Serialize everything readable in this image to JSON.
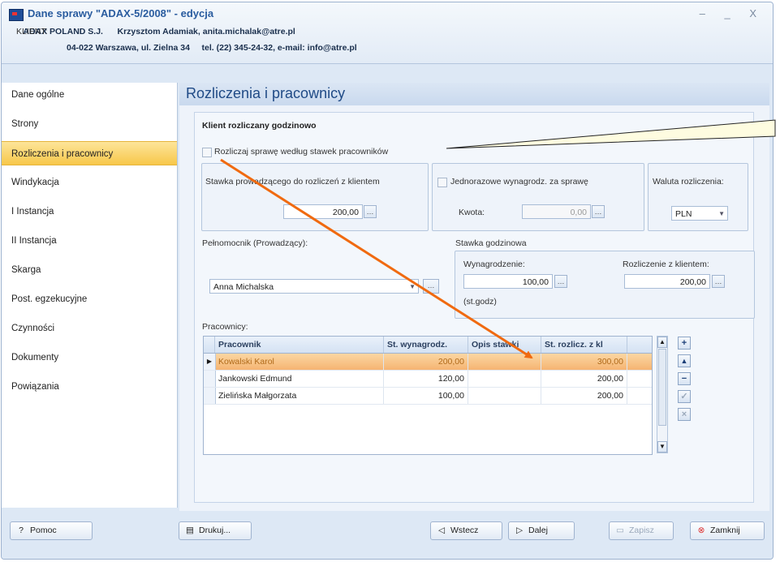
{
  "window": {
    "title": "Dane sprawy \"ADAX-5/2008\" - edycja",
    "controls": "– _ X"
  },
  "client": {
    "label": "KLIENT:",
    "name": "ADAX POLAND S.J.",
    "contacts": "Krzysztom Adamiak, anita.michalak@atre.pl",
    "address": "04-022 Warszawa, ul. Zielna 34",
    "phone_email": "tel. (22) 345-24-32, e-mail: info@atre.pl"
  },
  "sidebar": {
    "items": [
      {
        "label": "Dane ogólne"
      },
      {
        "label": "Strony"
      },
      {
        "label": "Rozliczenia i pracownicy",
        "active": true
      },
      {
        "label": "Windykacja"
      },
      {
        "label": "I Instancja"
      },
      {
        "label": "II Instancja"
      },
      {
        "label": "Skarga"
      },
      {
        "label": "Post. egzekucyjne"
      },
      {
        "label": "Czynności"
      },
      {
        "label": "Dokumenty"
      },
      {
        "label": "Powiązania"
      }
    ]
  },
  "panel": {
    "title": "Rozliczenia i pracownicy",
    "hourly_client": "Klient rozliczany godzinowo",
    "checkbox_label": "Rozliczaj sprawę według stawek pracowników",
    "rate_label": "Stawka prowadzącego do rozliczeń z klientem",
    "rate_value": "200,00",
    "one_time_label": "Jednorazowe wynagrodz. za sprawę",
    "amount_label": "Kwota:",
    "amount_value": "0,00",
    "currency_label": "Waluta rozliczenia:",
    "currency_value": "PLN",
    "attorney_label": "Pełnomocnik (Prowadzący):",
    "attorney_value": "Anna Michalska",
    "hourly_rate_label": "Stawka godzinowa",
    "remuneration_label": "Wynagrodzenie:",
    "remuneration_value": "100,00",
    "client_settlement_label": "Rozliczenie z klientem:",
    "client_settlement_value": "200,00",
    "per_hour": "(st.godz)",
    "employees_label": "Pracownicy:"
  },
  "grid": {
    "columns": [
      "Pracownik",
      "St. wynagrodz.",
      "Opis stawki",
      "St. rozlicz. z kl"
    ],
    "rows": [
      {
        "name": "Kowalski Karol",
        "wage": "200,00",
        "desc": "",
        "rate": "300,00",
        "selected": true
      },
      {
        "name": "Jankowski Edmund",
        "wage": "120,00",
        "desc": "",
        "rate": "200,00"
      },
      {
        "name": "Zielińska Małgorzata",
        "wage": "100,00",
        "desc": "",
        "rate": "200,00"
      }
    ]
  },
  "footer": {
    "help": "Pomoc",
    "print": "Drukuj...",
    "back": "Wstecz",
    "next": "Dalej",
    "save": "Zapisz",
    "close": "Zamknij"
  },
  "colors": {
    "accent": "#2a5c9f",
    "active_item": "#f7c74a",
    "selected_row": "#f5b472",
    "arrow": "#f06a10"
  }
}
